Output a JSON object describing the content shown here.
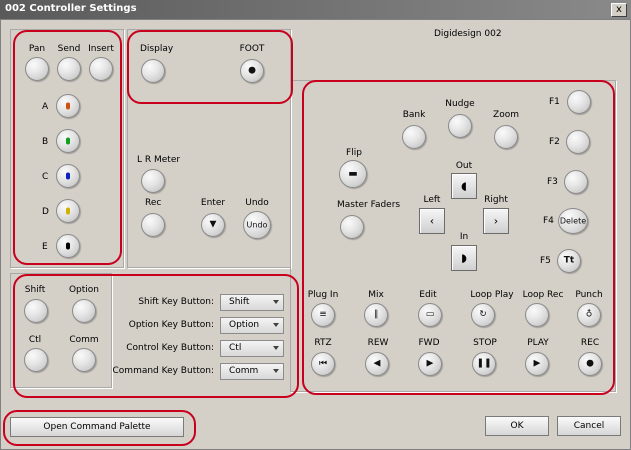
{
  "window": {
    "title": "002 Controller Settings",
    "close_label": "x",
    "device": "Digidesign 002"
  },
  "left": {
    "pan": "Pan",
    "send": "Send",
    "insert": "Insert",
    "rows": [
      {
        "label": "A",
        "color": "#d05010"
      },
      {
        "label": "B",
        "color": "#10a020"
      },
      {
        "label": "C",
        "color": "#1020c0"
      },
      {
        "label": "D",
        "color": "#d0b000"
      },
      {
        "label": "E",
        "color": "#000000"
      }
    ]
  },
  "display": {
    "display": "Display",
    "foot": "FOOT"
  },
  "middle": {
    "lr_meter": "L R Meter",
    "rec": "Rec",
    "enter": "Enter",
    "undo": "Undo",
    "undo_btn": "Undo"
  },
  "modifiers": {
    "shift": "Shift",
    "option": "Option",
    "ctl": "Ctl",
    "comm": "Comm",
    "rows": [
      {
        "label": "Shift Key Button:",
        "value": "Shift"
      },
      {
        "label": "Option Key Button:",
        "value": "Option"
      },
      {
        "label": "Control Key Button:",
        "value": "Ctl"
      },
      {
        "label": "Command Key Button:",
        "value": "Comm"
      }
    ]
  },
  "right": {
    "bank": "Bank",
    "nudge": "Nudge",
    "zoom": "Zoom",
    "flip": "Flip",
    "out": "Out",
    "left": "Left",
    "right": "Right",
    "in": "In",
    "master_faders": "Master Faders",
    "f1": "F1",
    "f2": "F2",
    "f3": "F3",
    "f4": "F4",
    "f4_btn": "Delete",
    "f5": "F5",
    "f5_btn": "Tt",
    "row1": [
      "Plug In",
      "Mix",
      "Edit",
      "Loop Play",
      "Loop Rec",
      "Punch"
    ],
    "row2": [
      "RTZ",
      "REW",
      "FWD",
      "STOP",
      "PLAY",
      "REC"
    ]
  },
  "footer": {
    "open_palette": "Open Command Palette",
    "ok": "OK",
    "cancel": "Cancel"
  }
}
